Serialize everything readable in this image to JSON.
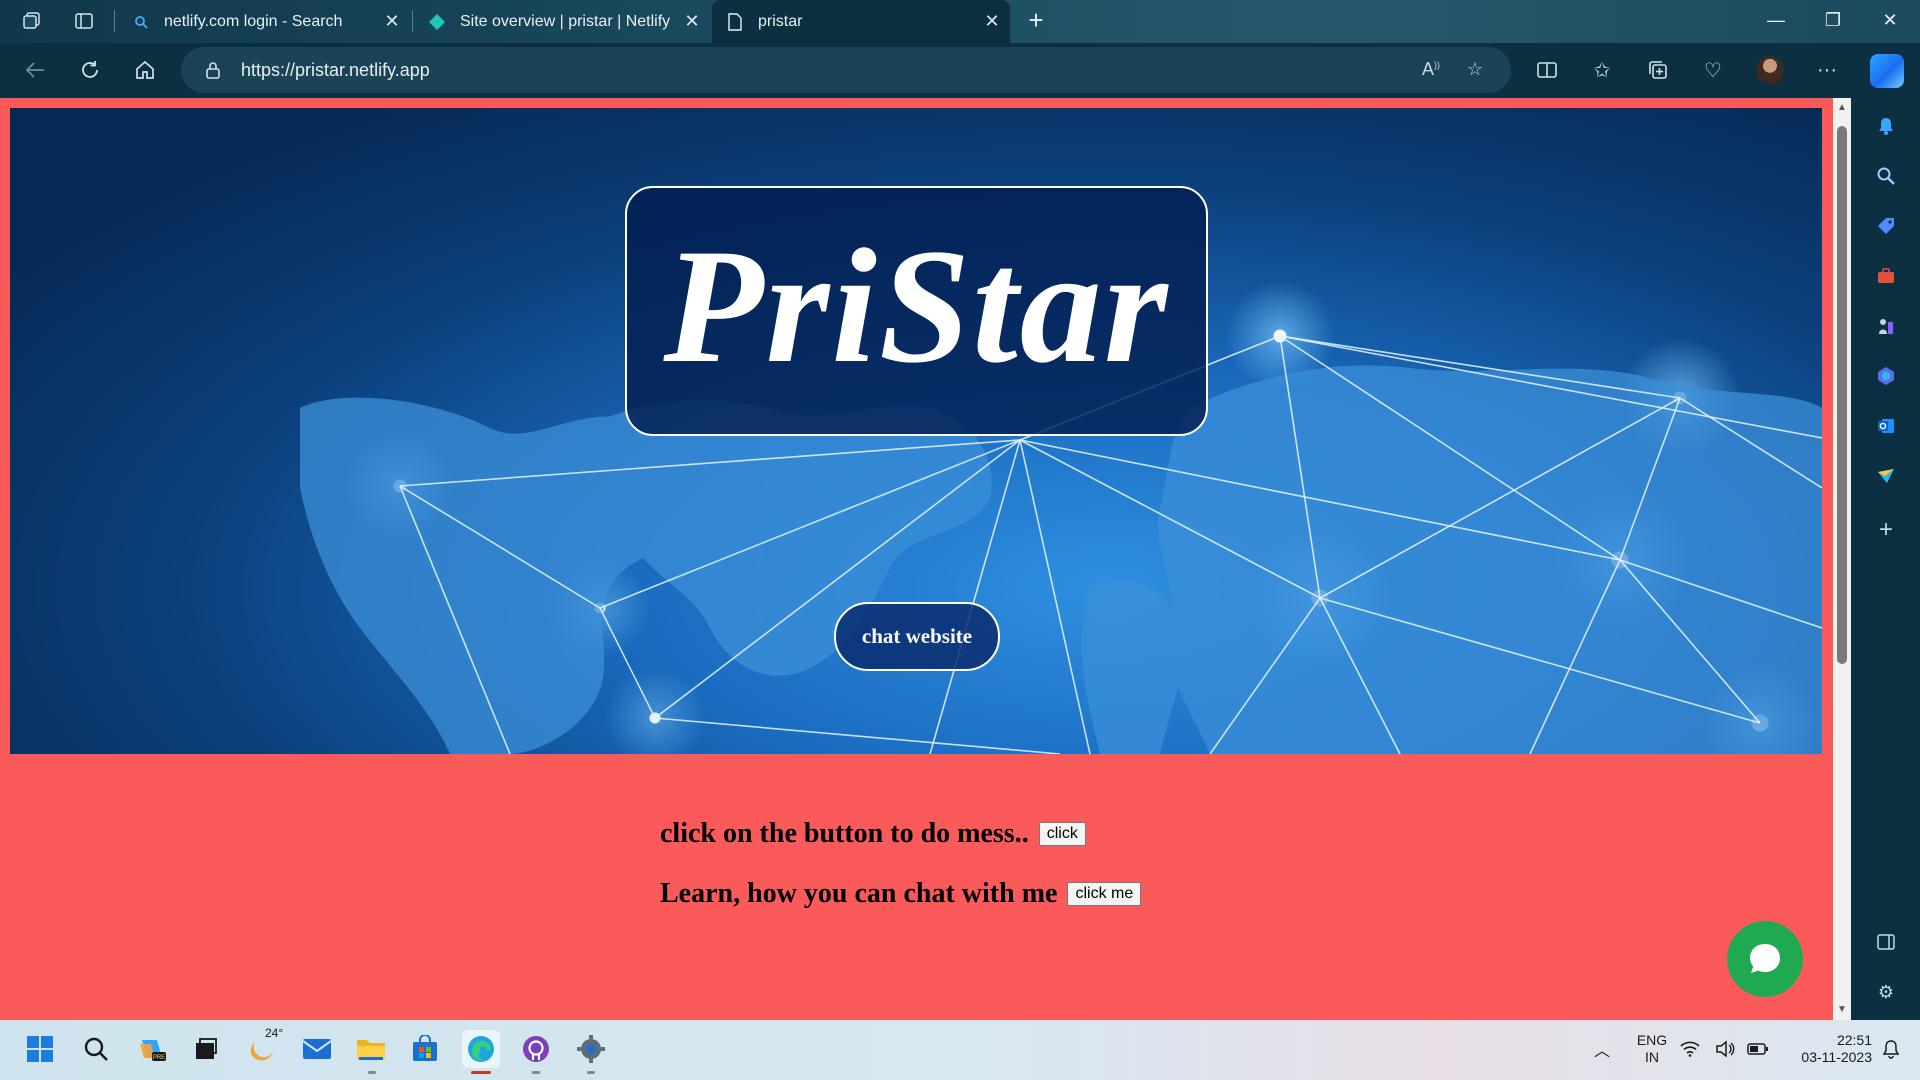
{
  "browser": {
    "tabs": [
      {
        "title": "netlify.com login - Search",
        "icon": "search-icon"
      },
      {
        "title": "Site overview | pristar | Netlify",
        "icon": "netlify-icon"
      },
      {
        "title": "pristar",
        "icon": "page-icon",
        "active": true
      }
    ],
    "new_tab_label": "+",
    "address": "https://pristar.netlify.app"
  },
  "page": {
    "logo_text": "PriStar",
    "hero_button": "chat website",
    "line1": "click on the button to do mess..",
    "line1_button": "click",
    "line2": "Learn, how you can chat with me",
    "line2_button": "click me",
    "background_color": "#fb5a5a",
    "chat_bubble_color": "#1faa51"
  },
  "taskbar": {
    "weather_temp": "24°",
    "language_top": "ENG",
    "language_bottom": "IN",
    "time": "22:51",
    "date": "03-11-2023"
  }
}
